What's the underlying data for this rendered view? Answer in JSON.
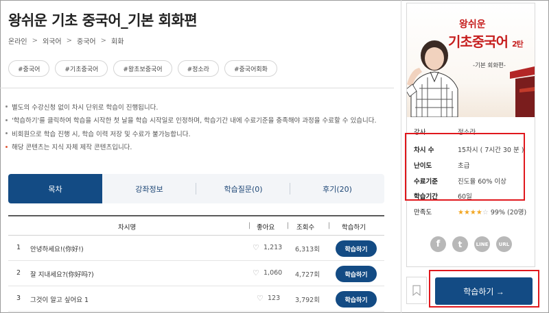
{
  "course": {
    "title": "왕쉬운 기초 중국어_기본 회화편",
    "breadcrumb": [
      "온라인",
      "외국어",
      "중국어",
      "회화"
    ],
    "breadcrumb_separator": ">",
    "tags": [
      "#중국어",
      "#기초중국어",
      "#왕초보중국어",
      "#정소라",
      "#중국어회화"
    ]
  },
  "notes": [
    {
      "text": "별도의 수강신청 없이 차시 단위로 학습이 진행됩니다.",
      "bullet_color": "#888888"
    },
    {
      "text": "'학습하기'를 클릭하여 학습을 시작한 첫 날을 학습 시작일로 인정하며, 학습기간 내에 수료기준을 충족해야 과정을 수료할 수 있습니다.",
      "bullet_color": "#888888"
    },
    {
      "text": "비회원으로 학습 진행 시, 학습 이력 저장 및 수료가 불가능합니다.",
      "bullet_color": "#888888"
    },
    {
      "text": "해당 콘텐츠는 지식 자체 제작 콘텐츠입니다.",
      "bullet_color": "#e05a3a"
    }
  ],
  "tabs": [
    "목차",
    "강좌정보",
    "학습질문(0)",
    "후기(20)"
  ],
  "table": {
    "headers": {
      "name": "차시명",
      "likes": "좋아요",
      "views": "조회수",
      "action": "학습하기"
    },
    "rows": [
      {
        "no": "1",
        "name": "안녕하세요!(你好!)",
        "likes": "1,213",
        "views": "6,313회",
        "button": "학습하기"
      },
      {
        "no": "2",
        "name": "잘 지내세요?(你好吗?)",
        "likes": "1,060",
        "views": "4,727회",
        "button": "학습하기"
      },
      {
        "no": "3",
        "name": "그것이 알고 싶어요 1",
        "likes": "123",
        "views": "3,792회",
        "button": "학습하기"
      }
    ]
  },
  "sidebar": {
    "thumbnail": {
      "brand": "왕쉬운",
      "big_text": "기초중국어",
      "edition": "2탄",
      "subtitle": "-기본 회화편-"
    },
    "info": [
      {
        "key": "강사",
        "value": "정소라"
      },
      {
        "key": "차시 수",
        "value": "15차시 ( 7시간 30 분 )"
      },
      {
        "key": "난이도",
        "value": "초급"
      },
      {
        "key": "수료기준",
        "value": "진도율 60% 이상"
      },
      {
        "key": "학습기간",
        "value": "60일"
      }
    ],
    "rating": {
      "key": "만족도",
      "stars_filled": 4,
      "stars_total": 5,
      "value": "99% (20명)"
    },
    "social": [
      "f",
      "t",
      "LINE",
      "URL"
    ],
    "cta": "학습하기 →"
  },
  "colors": {
    "primary": "#134b84",
    "highlight": "#e0171c",
    "star": "#f2a623"
  }
}
